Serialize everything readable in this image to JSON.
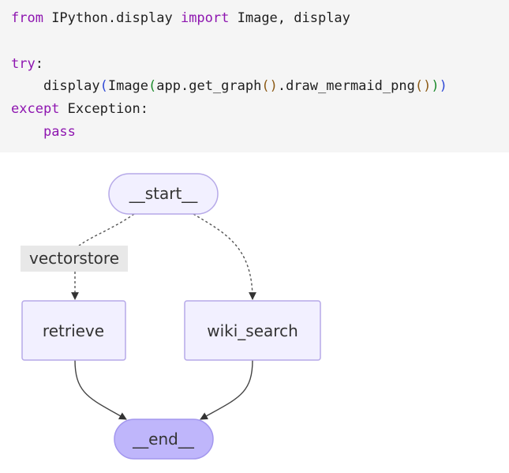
{
  "code": {
    "line1": {
      "kw_from": "from",
      "module": " IPython.display ",
      "kw_import": "import",
      "names": " Image, display"
    },
    "line2": "",
    "line3": {
      "kw_try": "try",
      "colon": ":"
    },
    "line4": {
      "indent_call": "    display",
      "p1_open": "(",
      "image_call": "Image",
      "p2_open": "(",
      "app_call": "app.get_graph",
      "p3_pair": "()",
      "method": ".draw_mermaid_png",
      "p3_pair_2": "()",
      "p2_close": ")",
      "p1_close": ")"
    },
    "line5": {
      "kw_except": "except",
      "rest": " Exception:"
    },
    "line6": {
      "indent": "    ",
      "kw_pass": "pass"
    }
  },
  "graph": {
    "nodes": {
      "start": "__start__",
      "retrieve": "retrieve",
      "wiki_search": "wiki_search",
      "end": "__end__"
    },
    "edge_labels": {
      "vectorstore": "vectorstore"
    },
    "colors": {
      "node_fill": "#f2f0ff",
      "node_stroke": "#b6a9e8",
      "end_fill": "#bfb6fb",
      "edge": "#333333",
      "label_bg": "#e8e8e8"
    }
  }
}
